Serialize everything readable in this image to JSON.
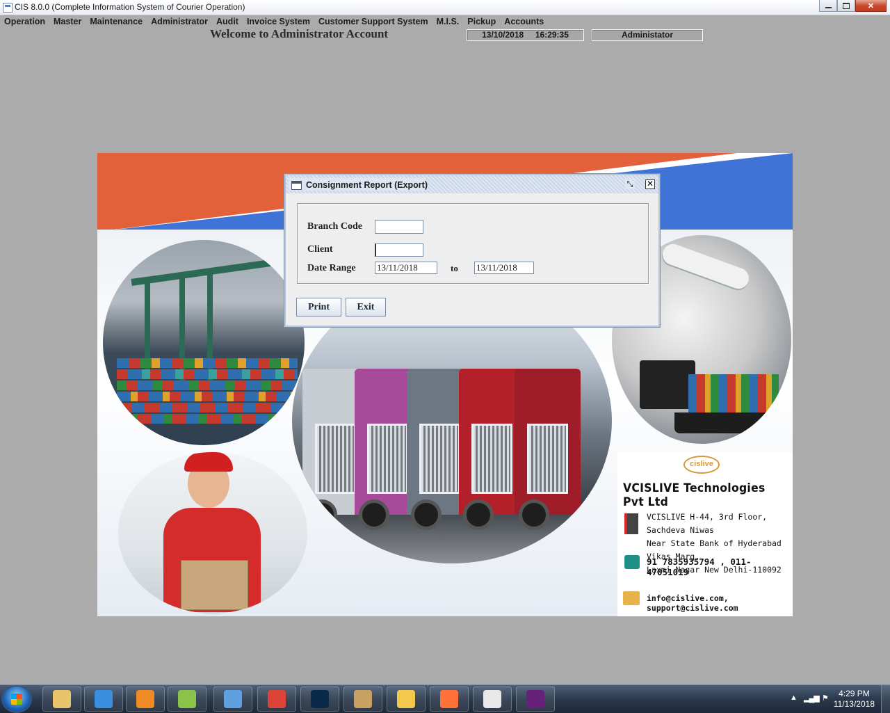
{
  "window": {
    "title": "CIS 8.0.0 (Complete Information System of Courier Operation)",
    "controls": {
      "minimize": "–",
      "maximize": "□",
      "close": "✕"
    }
  },
  "menu": [
    {
      "label": "Operation"
    },
    {
      "label": "Master"
    },
    {
      "label": "Maintenance"
    },
    {
      "label": "Administrator"
    },
    {
      "label": "Audit"
    },
    {
      "label": "Invoice System"
    },
    {
      "label": "Customer Support System"
    },
    {
      "label": "M.I.S."
    },
    {
      "label": "Pickup"
    },
    {
      "label": "Accounts"
    }
  ],
  "header": {
    "welcome": "Welcome to Administrator Account",
    "date": "13/10/2018",
    "time": "16:29:35",
    "user": "Administator"
  },
  "banner": {
    "company": "VCISLIVE Technologies Pvt Ltd",
    "logo_text": "cislive",
    "address_lines": [
      "VCISLIVE H-44, 3rd Floor, Sachdeva Niwas",
      "Near State Bank of Hyderabad Vikas Marg,",
      "Laxmi Nagar New Delhi-110092"
    ],
    "phone": "91 7835935794 , 011-47051019",
    "email": "info@cislive.com, support@cislive.com",
    "colors": {
      "orange": "#e2613a",
      "blue": "#3f73d6"
    }
  },
  "dialog": {
    "title": "Consignment Report (Export)",
    "branch_code_label": "Branch Code",
    "branch_code_value": "",
    "client_label": "Client",
    "client_value": "",
    "date_range_label": "Date Range",
    "date_from": "13/11/2018",
    "to_label": "to",
    "date_to": "13/11/2018",
    "print_button": "Print",
    "exit_button": "Exit"
  },
  "taskbar": {
    "apps": [
      {
        "icon": "file-explorer-icon",
        "color": "#e9c46a"
      },
      {
        "icon": "internet-explorer-icon",
        "color": "#3a8fe0"
      },
      {
        "icon": "media-player-icon",
        "color": "#f08a24"
      },
      {
        "icon": "notepad-plus-plus-icon",
        "color": "#8bc34a"
      },
      {
        "icon": "control-panel-icon",
        "color": "#5ea0e0"
      },
      {
        "icon": "chrome-icon",
        "color": "#db4437"
      },
      {
        "icon": "photoshop-icon",
        "color": "#0b2a4a"
      },
      {
        "icon": "paint-icon",
        "color": "#c7a062"
      },
      {
        "icon": "tools-icon",
        "color": "#f2c94c"
      },
      {
        "icon": "firefox-icon",
        "color": "#ff7139"
      },
      {
        "icon": "java-icon",
        "color": "#e8e8e8"
      },
      {
        "icon": "visual-studio-icon",
        "color": "#68217a"
      }
    ],
    "clock_time": "4:29 PM",
    "clock_date": "11/13/2018"
  }
}
